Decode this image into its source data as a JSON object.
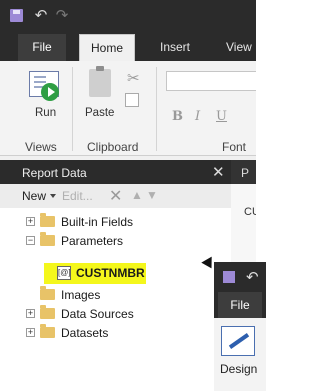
{
  "ribbon_tabs": [
    {
      "label": "File"
    },
    {
      "label": "Home"
    },
    {
      "label": "Insert"
    },
    {
      "label": "View"
    }
  ],
  "ribbon": {
    "run_label": "Run",
    "paste_label": "Paste",
    "groups": {
      "views": "Views",
      "clipboard": "Clipboard",
      "font": "Font"
    },
    "format_buttons": [
      "B",
      "I",
      "U"
    ]
  },
  "report_data": {
    "title": "Report Data",
    "side_label": "P",
    "side_text": "CUS",
    "toolbar": {
      "new_label": "New",
      "edit_label": "Edit..."
    },
    "tree": [
      {
        "label": "Built-in Fields",
        "expander": "+"
      },
      {
        "label": "Parameters",
        "expander": "−"
      },
      {
        "label": "CUSTNMBR",
        "kind": "parameter",
        "highlighted": true
      },
      {
        "label": "Images"
      },
      {
        "label": "Data Sources",
        "expander": "+"
      },
      {
        "label": "Datasets",
        "expander": "+"
      }
    ]
  },
  "second_window": {
    "file_tab": "File",
    "design_label": "Design"
  },
  "colors": {
    "dark_chrome": "#2b2b2b",
    "highlight": "#f4f71c",
    "folder": "#e8c368"
  }
}
